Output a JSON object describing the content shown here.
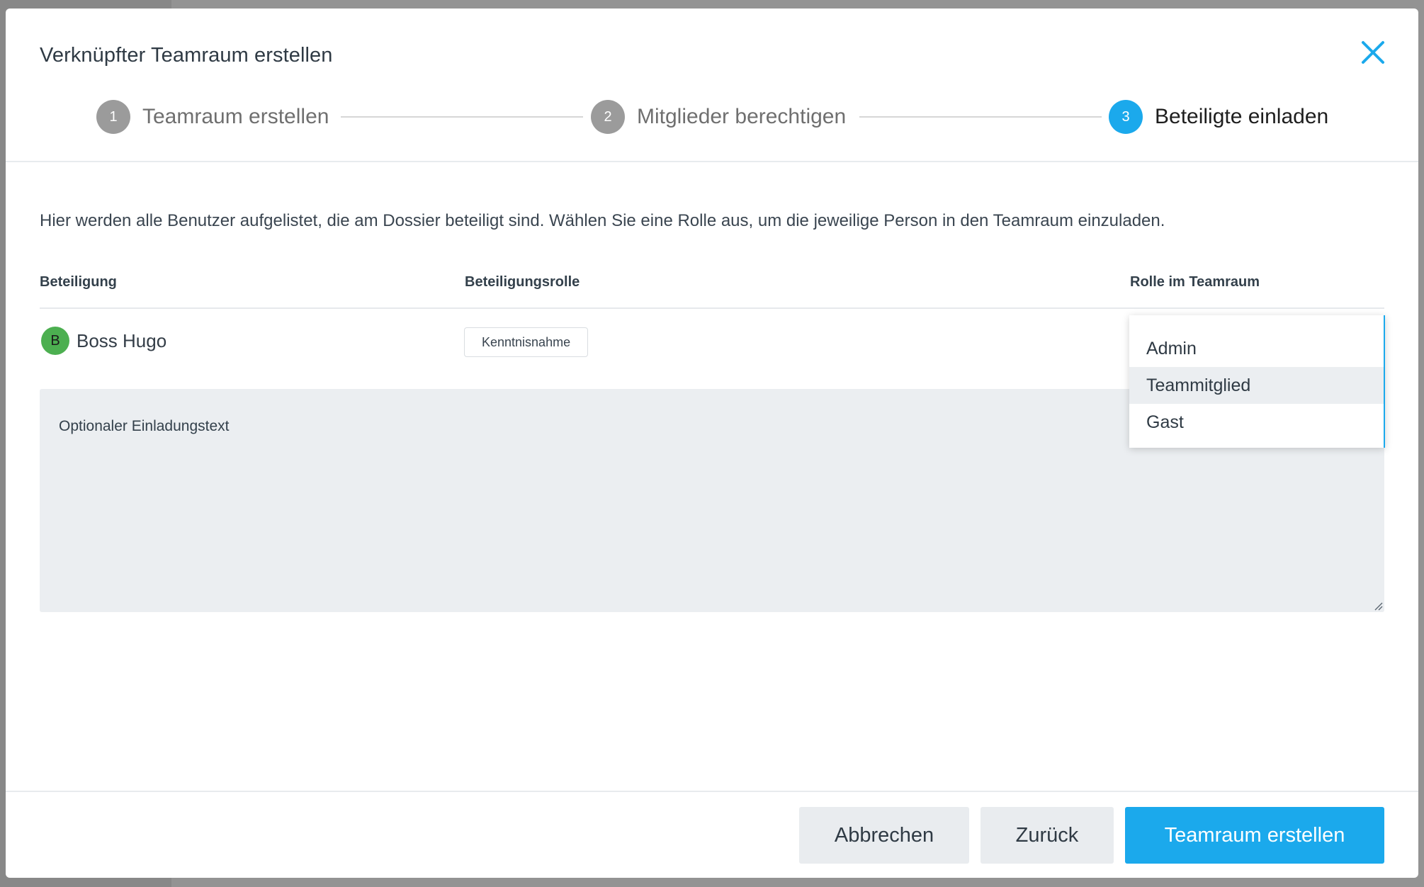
{
  "modal": {
    "title": "Verknüpfter Teamraum erstellen",
    "close_icon": "close-icon"
  },
  "stepper": {
    "steps": [
      {
        "number": "1",
        "label": "Teamraum erstellen",
        "active": false
      },
      {
        "number": "2",
        "label": "Mitglieder berechtigen",
        "active": false
      },
      {
        "number": "3",
        "label": "Beteiligte einladen",
        "active": true
      }
    ]
  },
  "intro_text": "Hier werden alle Benutzer aufgelistet, die am Dossier beteiligt sind. Wählen Sie eine Rolle aus, um die jeweilige Person in den Teamraum einzuladen.",
  "table": {
    "headers": [
      "Beteiligung",
      "Beteiligungsrolle",
      "Rolle im Teamraum"
    ],
    "rows": [
      {
        "avatar_letter": "B",
        "name": "Boss Hugo",
        "participation_role": "Kenntnisnahme"
      }
    ]
  },
  "invite_text": {
    "placeholder": "Optionaler Einladungstext",
    "value": ""
  },
  "role_dropdown": {
    "options": [
      "Admin",
      "Teammitglied",
      "Gast"
    ],
    "highlighted": "Teammitglied"
  },
  "footer": {
    "cancel_label": "Abbrechen",
    "back_label": "Zurück",
    "submit_label": "Teamraum erstellen"
  },
  "colors": {
    "accent": "#1ba9ec",
    "avatar": "#4caf50",
    "inactive_step": "#9b9b9b",
    "secondary_button": "#e9ecef"
  }
}
